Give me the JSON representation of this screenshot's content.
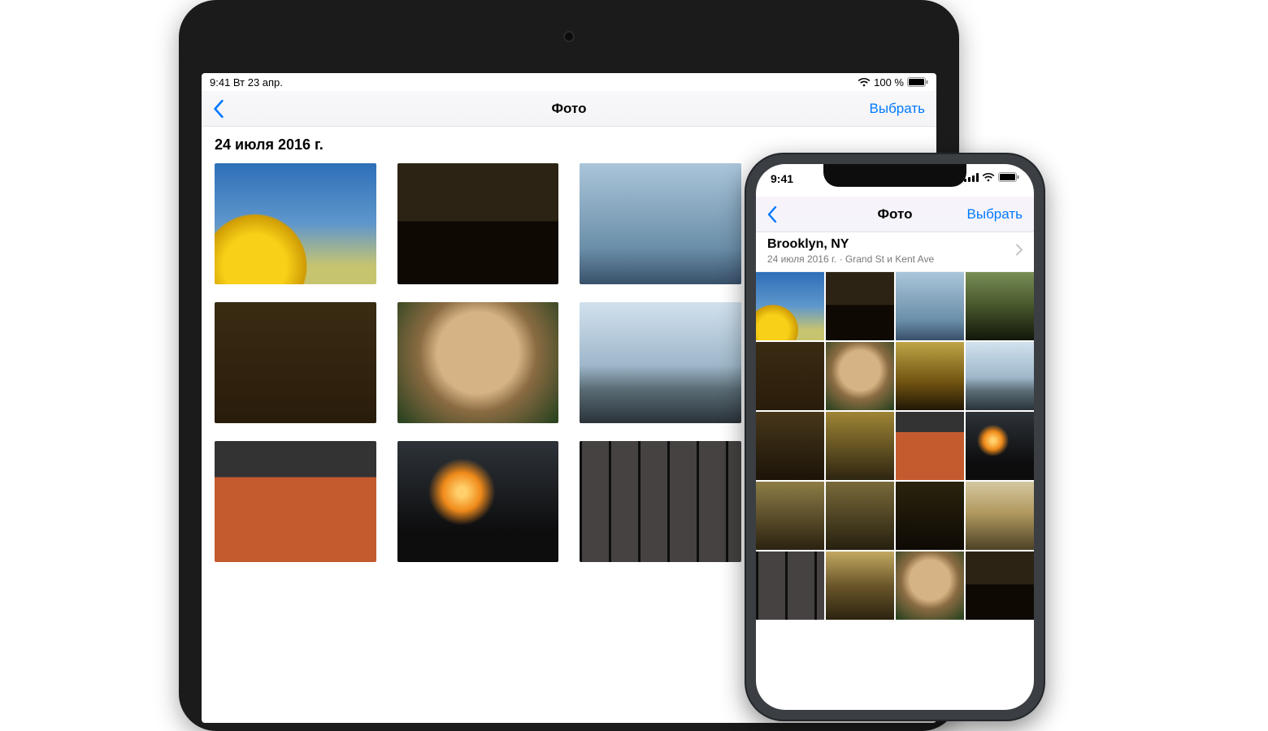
{
  "ipad": {
    "status": {
      "left": "9:41  Вт 23 апр.",
      "battery_text": "100 %"
    },
    "nav": {
      "title": "Фото",
      "select": "Выбрать"
    },
    "date_header": "24 июля 2016 г."
  },
  "iphone": {
    "status": {
      "time": "9:41"
    },
    "nav": {
      "title": "Фото",
      "select": "Выбрать"
    },
    "header": {
      "location": "Brooklyn, NY",
      "subline_date": "24 июля 2016 г.",
      "subline_sep": " · ",
      "subline_place": "Grand St и Kent Ave"
    }
  }
}
